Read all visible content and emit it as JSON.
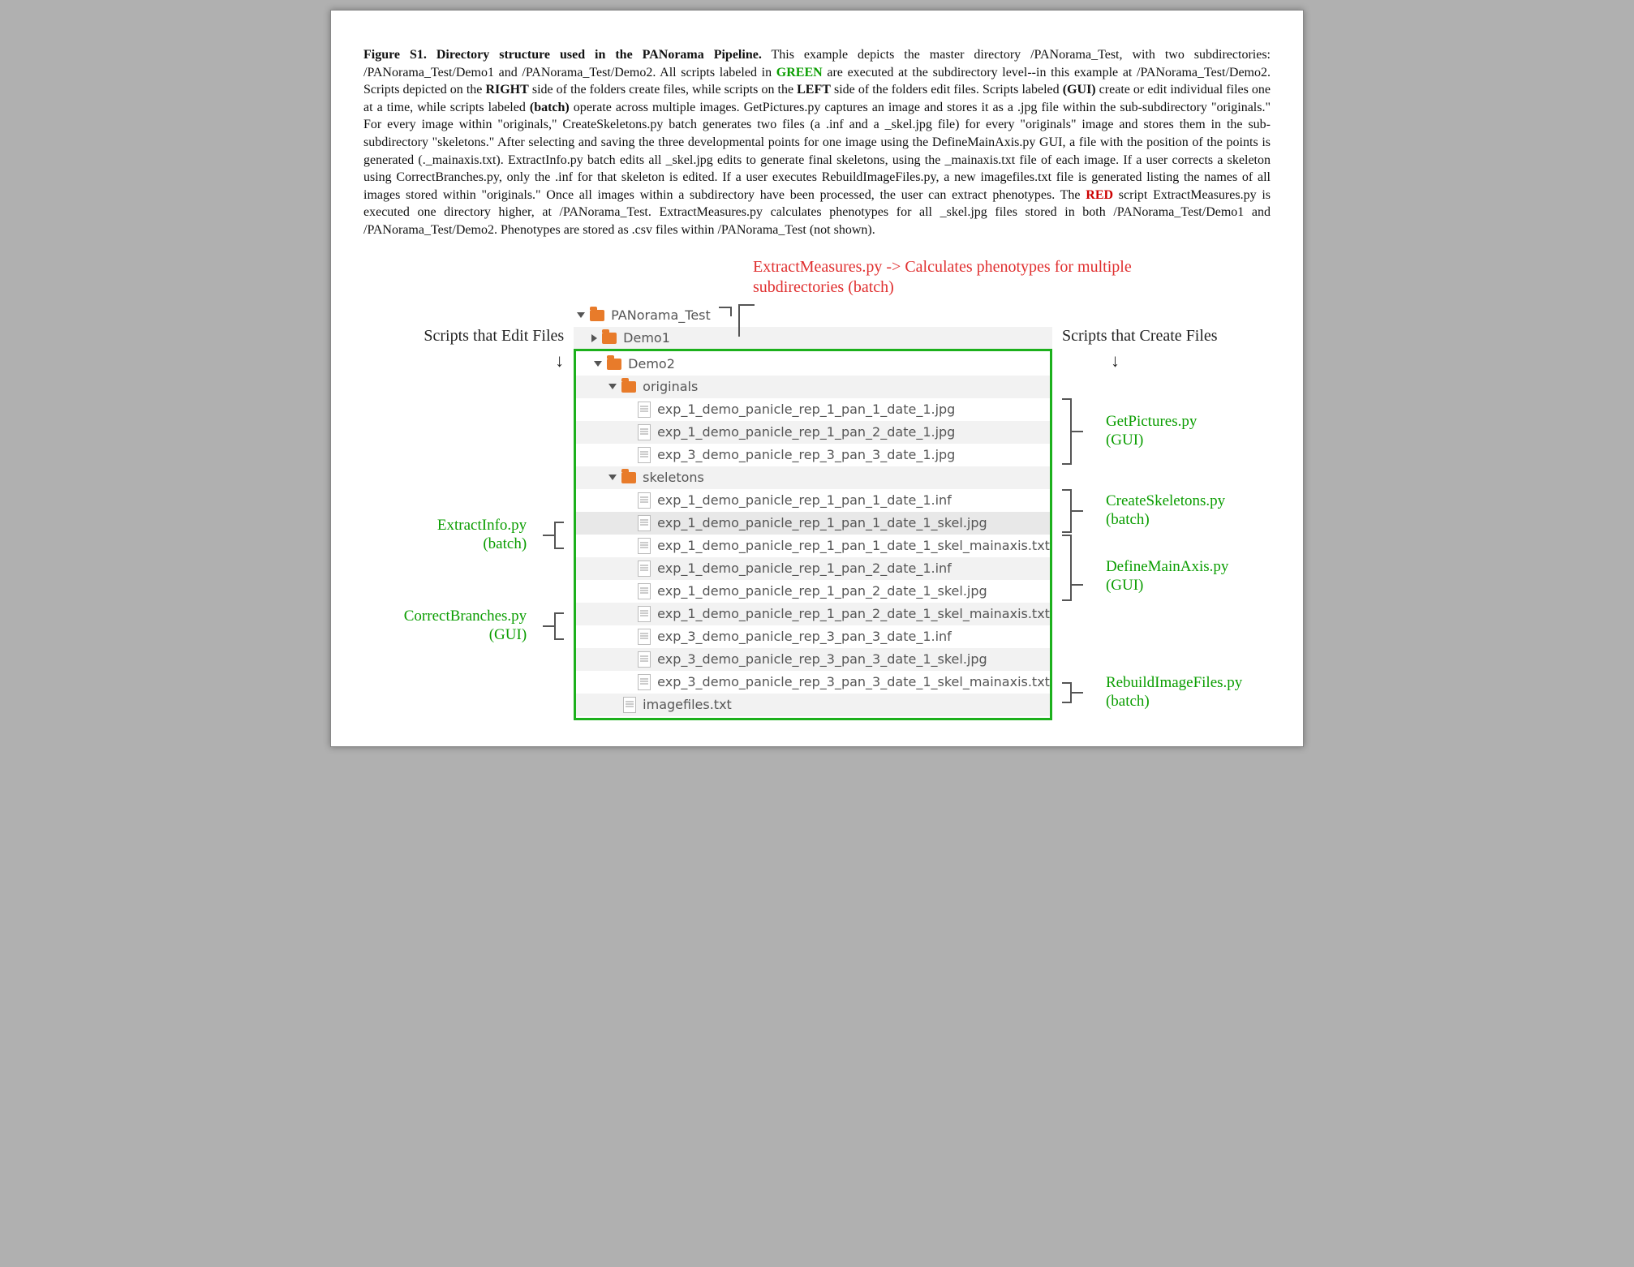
{
  "caption": {
    "fig_label": "Figure S1.  Directory structure used in the PANorama Pipeline.",
    "text_1": " This example depicts the master directory /PANorama_Test, with two subdirectories: /PANorama_Test/Demo1 and /PANorama_Test/Demo2.  All scripts labeled in ",
    "green_word": "GREEN",
    "text_2": " are executed at the subdirectory level--in this example at /PANorama_Test/Demo2.  Scripts depicted on the ",
    "bold_right": "RIGHT",
    "text_3": " side of the folders create files, while scripts on the ",
    "bold_left": "LEFT",
    "text_4": " side of the folders edit files.  Scripts labeled ",
    "bold_gui": "(GUI)",
    "text_5": " create or edit individual files one at a time, while scripts labeled ",
    "bold_batch": "(batch)",
    "text_6": " operate across multiple images.  GetPictures.py captures an image and stores it as a .jpg file within the sub-subdirectory \"originals.\"  For every image within \"originals,\" CreateSkeletons.py batch generates two files (a .inf and a _skel.jpg file) for every \"originals\" image and stores them in the sub-subdirectory \"skeletons.\"  After selecting and saving the three developmental points for one image using the DefineMainAxis.py GUI, a file with the position of the points is generated (._mainaxis.txt).  ExtractInfo.py batch edits all _skel.jpg edits to generate final skeletons, using the _mainaxis.txt file of each image.  If a user corrects a skeleton using CorrectBranches.py, only the .inf for that skeleton is edited.  If a user executes RebuildImageFiles.py, a new imagefiles.txt file is generated listing the names of all images stored within \"originals.\"  Once all images within a subdirectory have been processed, the user can extract phenotypes.  The ",
    "red_word": "RED",
    "text_7": " script ExtractMeasures.py is executed one directory higher, at /PANorama_Test.  ExtractMeasures.py calculates phenotypes for all _skel.jpg files stored in both /PANorama_Test/Demo1 and /PANorama_Test/Demo2.  Phenotypes are stored as .csv files within /PANorama_Test (not shown)."
  },
  "red_callout": "ExtractMeasures.py -> Calculates phenotypes for multiple subdirectories (batch)",
  "left_heading": "Scripts that Edit Files",
  "right_heading": "Scripts that Create Files",
  "left_labels": {
    "extractinfo": "ExtractInfo.py",
    "extractinfo_sub": "(batch)",
    "correctbranches": "CorrectBranches.py",
    "correctbranches_sub": "(GUI)"
  },
  "right_labels": {
    "getpictures": "GetPictures.py",
    "getpictures_sub": "(GUI)",
    "createskeletons": "CreateSkeletons.py",
    "createskeletons_sub": "(batch)",
    "definemainaxis": "DefineMainAxis.py",
    "definemainaxis_sub": "(GUI)",
    "rebuild": "RebuildImageFiles.py",
    "rebuild_sub": "(batch)"
  },
  "tree": {
    "root": "PANorama_Test",
    "demo1": "Demo1",
    "demo2": "Demo2",
    "originals": "originals",
    "skeletons": "skeletons",
    "originals_files": [
      "exp_1_demo_panicle_rep_1_pan_1_date_1.jpg",
      "exp_1_demo_panicle_rep_1_pan_2_date_1.jpg",
      "exp_3_demo_panicle_rep_3_pan_3_date_1.jpg"
    ],
    "skeletons_files": [
      "exp_1_demo_panicle_rep_1_pan_1_date_1.inf",
      "exp_1_demo_panicle_rep_1_pan_1_date_1_skel.jpg",
      "exp_1_demo_panicle_rep_1_pan_1_date_1_skel_mainaxis.txt",
      "exp_1_demo_panicle_rep_1_pan_2_date_1.inf",
      "exp_1_demo_panicle_rep_1_pan_2_date_1_skel.jpg",
      "exp_1_demo_panicle_rep_1_pan_2_date_1_skel_mainaxis.txt",
      "exp_3_demo_panicle_rep_3_pan_3_date_1.inf",
      "exp_3_demo_panicle_rep_3_pan_3_date_1_skel.jpg",
      "exp_3_demo_panicle_rep_3_pan_3_date_1_skel_mainaxis.txt"
    ],
    "imagefiles": "imagefiles.txt"
  }
}
